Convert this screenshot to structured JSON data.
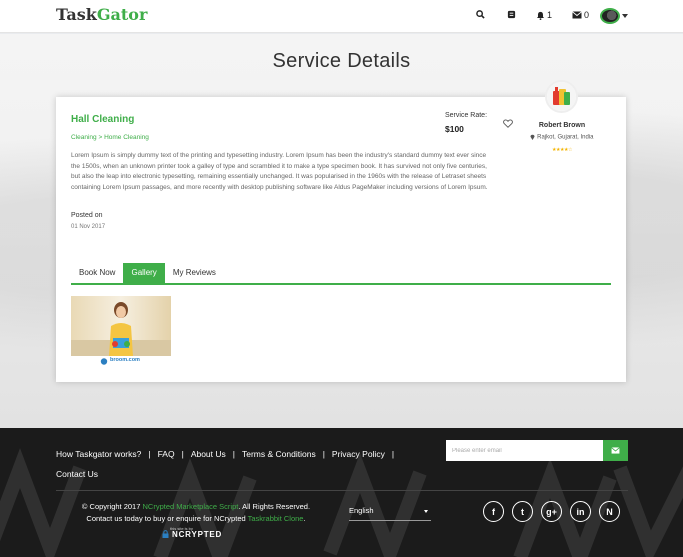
{
  "header": {
    "logo_part1": "Task",
    "logo_part2": "Gator",
    "notifications_count": "1",
    "messages_count": "0"
  },
  "page": {
    "title": "Service Details"
  },
  "service": {
    "title": "Hall Cleaning",
    "breadcrumb": "Cleaning > Home Cleaning",
    "description": "Lorem Ipsum is simply dummy text of the printing and typesetting industry. Lorem Ipsum has been the industry's standard dummy text ever since the 1500s, when an unknown printer took a galley of type and scrambled it to make a type specimen book. It has survived not only five centuries, but also the leap into electronic typesetting, remaining essentially unchanged. It was popularised in the 1960s with the release of Letraset sheets containing Lorem Ipsum passages, and more recently with desktop publishing software like Aldus PageMaker including versions of Lorem Ipsum.",
    "posted_label": "Posted on",
    "posted_date": "01 Nov 2017",
    "rate_label": "Service Rate:",
    "rate_value": "$100"
  },
  "provider": {
    "name": "Robert Brown",
    "location": "Rajkot, Gujarat, India",
    "stars": "★★★★☆"
  },
  "tabs": [
    {
      "label": "Book Now",
      "active": false
    },
    {
      "label": "Gallery",
      "active": true
    },
    {
      "label": "My Reviews",
      "active": false
    }
  ],
  "gallery": {
    "caption": "broom.com"
  },
  "footer": {
    "links": [
      "How Taskgator works?",
      "FAQ",
      "About Us",
      "Terms & Conditions",
      "Privacy Policy",
      "Contact Us"
    ],
    "newsletter_placeholder": "Please enter email",
    "copyright_line1_a": "© Copyright 2017 ",
    "copyright_line1_link": "NCrypted Marketplace Script",
    "copyright_line1_b": ". All Rights Reserved.",
    "copyright_line2_a": "Contact us today to buy or enquire for NCrypted ",
    "copyright_line2_link": "Taskrabbit Clone",
    "copyright_line2_b": ".",
    "brand_small": "this site is by",
    "brand": "NCRYPTED",
    "language": "English",
    "social": [
      "f",
      "t",
      "g+",
      "in",
      "N"
    ]
  },
  "colors": {
    "accent": "#3fae49",
    "footer_bg": "#1b1b1b"
  }
}
